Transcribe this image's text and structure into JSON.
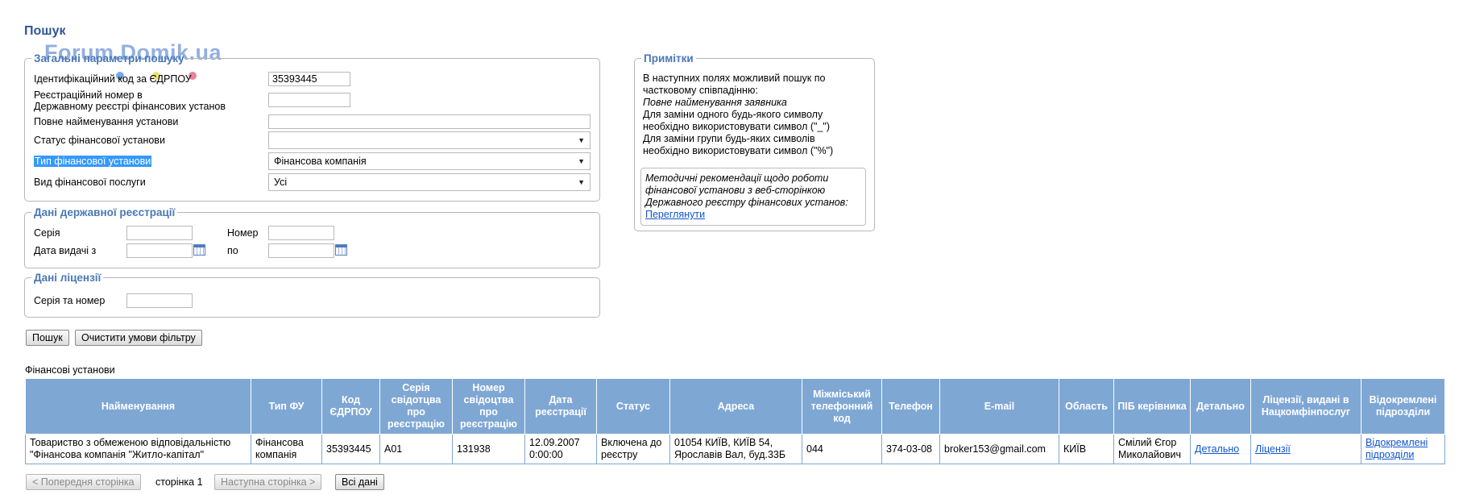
{
  "page": {
    "title": "Пошук",
    "watermark": "Forum.Domik.ua"
  },
  "general": {
    "legend": "Загальні параметри пошуку",
    "edrpou_label": "Ідентифікаційний код за ЄДРПОУ",
    "edrpou_value": "35393445",
    "regnum_label_line1": "Реєстраційний номер в",
    "regnum_label_line2": "Державному реєстрі фінансових установ",
    "regnum_value": "",
    "fullname_label": "Повне найменування установи",
    "fullname_value": "",
    "status_label": "Статус фінансової установи",
    "status_value": "",
    "type_label": "Тип фінансової установи",
    "type_value": "Фінансова компанія",
    "service_label": "Вид фінансової послуги",
    "service_value": "Усі"
  },
  "registration": {
    "legend": "Дані державної реєстрації",
    "series_label": "Серія",
    "series_value": "",
    "number_label": "Номер",
    "number_value": "",
    "date_from_label": "Дата видачі з",
    "date_from_value": "",
    "date_to_label": "по",
    "date_to_value": ""
  },
  "license": {
    "legend": "Дані ліцензії",
    "series_number_label": "Серія та номер",
    "series_number_value": ""
  },
  "actions": {
    "search": "Пошук",
    "clear": "Очистити умови фільтру"
  },
  "notes": {
    "legend": "Примітки",
    "line1": "В наступних полях можливий пошук по",
    "line2": "частковому співпадінню:",
    "line3": "Повне найменування заявника",
    "line4": "Для заміни одного будь-якого символу",
    "line5": "необхідно використовувати символ (\"_\")",
    "line6": "Для заміни групи будь-яких символів",
    "line7": "необхідно використовувати символ (\"%\")",
    "rec_line1": "Методичні рекомендації щодо роботи",
    "rec_line2": "фінансової установи з веб-сторінкою",
    "rec_line3": "Державного реєстру фінансових установ:",
    "rec_link": "Переглянути"
  },
  "results": {
    "caption": "Фінансові установи",
    "headers": [
      "Найменування",
      "Тип ФУ",
      "Код ЄДРПОУ",
      "Серія свідотцва про реєстрацію",
      "Номер свідоцтва про реєстрацію",
      "Дата реєстрації",
      "Статус",
      "Адреса",
      "Міжміський телефонний код",
      "Телефон",
      "E-mail",
      "Область",
      "ПІБ керівника",
      "Детально",
      "Ліцензії, видані в Нацкомфінпослуг",
      "Відокремлені підрозділи"
    ],
    "row": {
      "name": "Товариство з обмеженою відповідальністю \"Фінансова компанія \"Житло-капітал\"",
      "type": "Фінансова компанія",
      "code": "35393445",
      "cert_series": "А01",
      "cert_number": "131938",
      "reg_date": "12.09.2007 0:00:00",
      "status": "Включена до реєстру",
      "address": "01054 КИЇВ, КИЇВ 54, Ярославів Вал, буд.33Б",
      "area_code": "044",
      "phone": "374-03-08",
      "email": "broker153@gmail.com",
      "region": "КИЇВ",
      "head": "Смілий Єгор Миколайович",
      "details": "Детально",
      "licenses": "Ліцензії",
      "branches": "Відокремлені підрозділи"
    }
  },
  "pager": {
    "prev": "< Попередня сторінка",
    "page_label": "сторінка 1",
    "next": "Наступна сторінка >",
    "all": "Всі дані"
  },
  "colors": {
    "header_bg": "#7fa7d4",
    "legend": "#4a78b5",
    "title": "#2f5597",
    "link": "#1155cc"
  }
}
